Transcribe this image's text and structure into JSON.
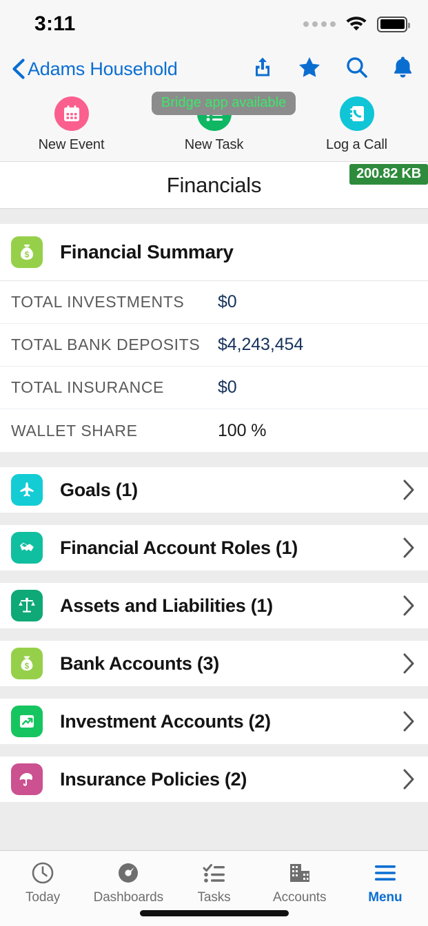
{
  "status_bar": {
    "time": "3:11",
    "cellular_icon": "signal-dots-icon",
    "wifi_icon": "wifi-icon",
    "battery_icon": "battery-full-icon"
  },
  "nav_bar": {
    "back_icon": "chevron-left-icon",
    "back_label": "Adams Household",
    "actions": [
      {
        "name": "share-icon",
        "label": "Share"
      },
      {
        "name": "star-icon",
        "label": "Favorite"
      },
      {
        "name": "search-icon",
        "label": "Search"
      },
      {
        "name": "bell-icon",
        "label": "Notifications"
      }
    ]
  },
  "quick_actions": [
    {
      "label": "New Event",
      "icon": "calendar-icon",
      "color": "#fb5f8d"
    },
    {
      "label": "New Task",
      "icon": "task-list-icon",
      "color": "#0fb763"
    },
    {
      "label": "Log a Call",
      "icon": "phone-book-icon",
      "color": "#0fc5d6"
    }
  ],
  "toast": {
    "text": "Bridge app available"
  },
  "header": {
    "page_title": "Financials",
    "size_badge": "200.82 KB"
  },
  "financial_summary": {
    "title": "Financial Summary",
    "icon": "money-bag-icon",
    "icon_color": "#96d04a",
    "rows": [
      {
        "label": "TOTAL INVESTMENTS",
        "value": "$0",
        "style": "link"
      },
      {
        "label": "TOTAL BANK DEPOSITS",
        "value": "$4,243,454",
        "style": "link"
      },
      {
        "label": "TOTAL INSURANCE",
        "value": "$0",
        "style": "link"
      },
      {
        "label": "WALLET SHARE",
        "value": "100 %",
        "style": "plain"
      }
    ]
  },
  "related_lists": [
    {
      "label": "Goals (1)",
      "icon": "airplane-icon",
      "color": "#14ccd4"
    },
    {
      "label": "Financial Account Roles (1)",
      "icon": "handshake-icon",
      "color": "#0fbfa0"
    },
    {
      "label": "Assets and Liabilities (1)",
      "icon": "scales-icon",
      "color": "#0fa877"
    },
    {
      "label": "Bank Accounts (3)",
      "icon": "money-bag-icon",
      "color": "#96d04a"
    },
    {
      "label": "Investment Accounts (2)",
      "icon": "chart-arrow-icon",
      "color": "#16c55f"
    },
    {
      "label": "Insurance Policies (2)",
      "icon": "umbrella-icon",
      "color": "#cb5190"
    }
  ],
  "tab_bar": {
    "tabs": [
      {
        "label": "Today",
        "icon": "clock-icon",
        "active": false
      },
      {
        "label": "Dashboards",
        "icon": "gauge-icon",
        "active": false
      },
      {
        "label": "Tasks",
        "icon": "checklist-icon",
        "active": false
      },
      {
        "label": "Accounts",
        "icon": "buildings-icon",
        "active": false
      },
      {
        "label": "Menu",
        "icon": "hamburger-icon",
        "active": true
      }
    ]
  },
  "colors": {
    "accent_blue": "#0a6ed1",
    "value_blue": "#16325c",
    "badge_green": "#2e8b3c",
    "toast_green": "#3ce76a"
  }
}
